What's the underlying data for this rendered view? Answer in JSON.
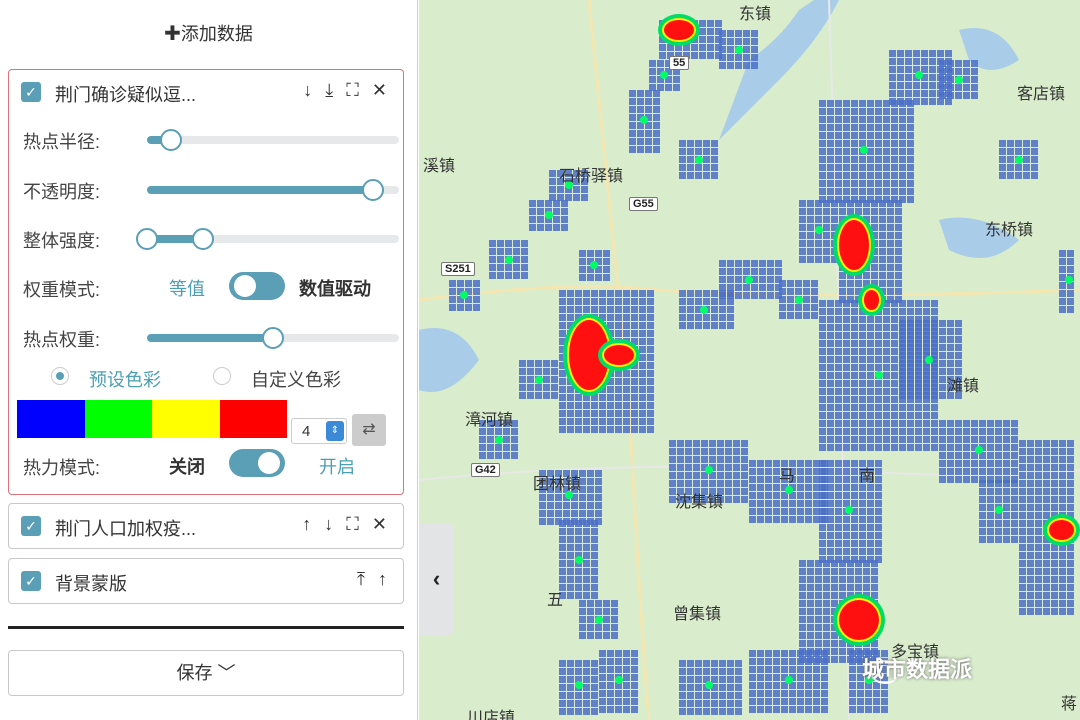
{
  "panel": {
    "add_data_label": "添加数据",
    "layers": [
      {
        "title": "荆门确诊疑似逗...",
        "checked": true,
        "tools": [
          "↓",
          "⤓",
          "⛶",
          "✕"
        ]
      },
      {
        "title": "荆门人口加权疫...",
        "checked": true,
        "tools": [
          "↑",
          "↓",
          "⛶",
          "✕"
        ]
      },
      {
        "title": "背景蒙版",
        "checked": true,
        "tools": [
          "⤒",
          "↑"
        ]
      }
    ],
    "settings": {
      "radius_label": "热点半径:",
      "radius_value": 0.1,
      "opacity_label": "不透明度:",
      "opacity_value": 0.9,
      "intensity_label": "整体强度:",
      "intensity_range": [
        0.0,
        0.22
      ],
      "weight_mode_label": "权重模式:",
      "weight_mode_off": "等值",
      "weight_mode_on": "数值驱动",
      "hot_weight_label": "热点权重:",
      "hot_weight_value": 0.5,
      "preset_color_label": "预设色彩",
      "custom_color_label": "自定义色彩",
      "palette": [
        "#0000ff",
        "#00ff00",
        "#ffff00",
        "#ff0000"
      ],
      "color_count": "4",
      "heat_mode_label": "热力模式:",
      "heat_mode_off": "关闭",
      "heat_mode_on": "开启"
    },
    "save_label": "保存 ﹀"
  },
  "map": {
    "towns": [
      "石桥驿镇",
      "溪镇",
      "东桥镇",
      "客店镇",
      "漳河镇",
      "团林镇",
      "沈集镇",
      "曾集镇",
      "多宝镇",
      "川店镇",
      "五",
      "滩镇",
      "东镇",
      "南",
      "马",
      "蒋"
    ],
    "roads": [
      "G55",
      "S251",
      "G42",
      "55"
    ],
    "watermark": "城市数据派"
  },
  "colors": {
    "accent": "#5a9fb5",
    "active_border": "#e0707a",
    "map_bg": "#d9eccc",
    "cell": "#4a6fc8"
  }
}
